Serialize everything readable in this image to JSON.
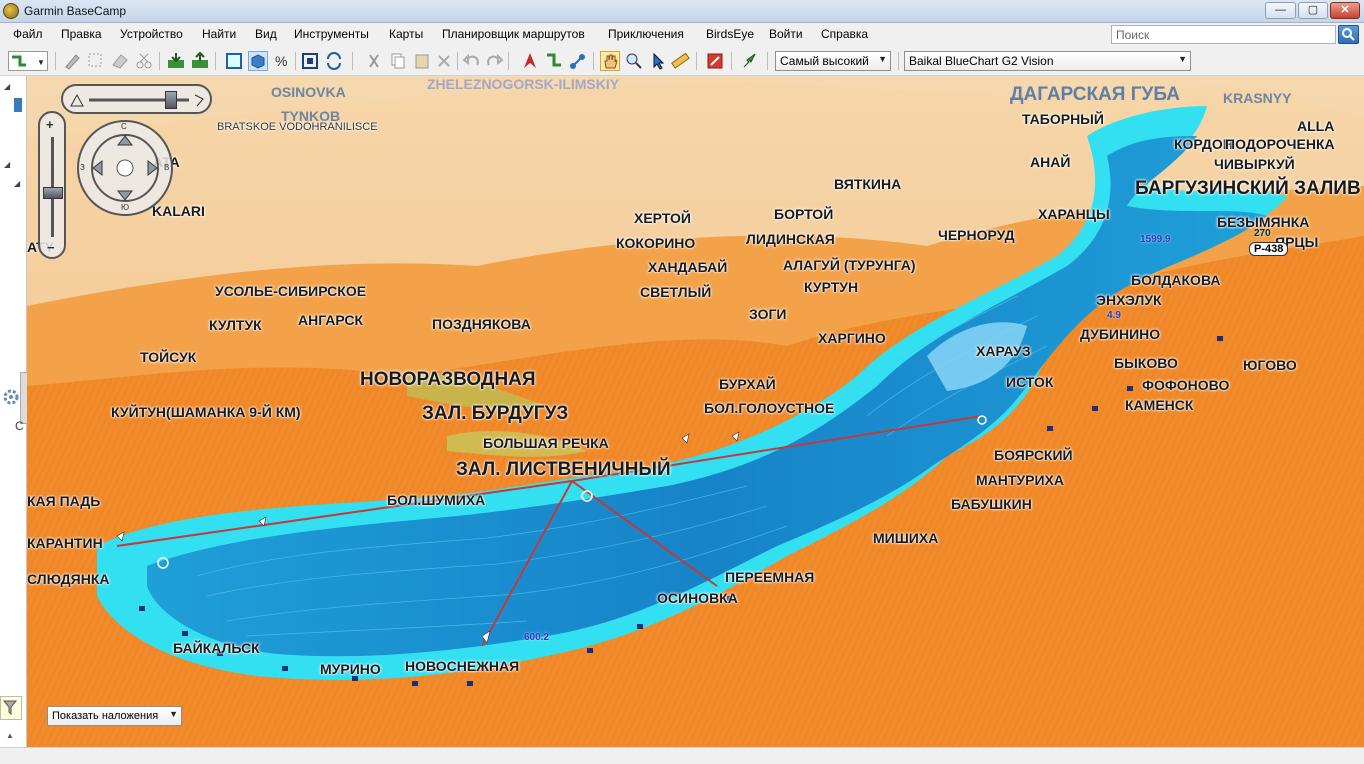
{
  "window": {
    "title": "Garmin BaseCamp",
    "min_glyph": "—",
    "max_glyph": "▢",
    "close_glyph": "✕"
  },
  "menu": [
    "Файл",
    "Правка",
    "Устройство",
    "Найти",
    "Вид",
    "Инструменты",
    "Карты",
    "Планировщик маршрутов",
    "Приключения",
    "BirdsEye",
    "Войти",
    "Справка"
  ],
  "search": {
    "placeholder": "Поиск"
  },
  "toolbar": {
    "detail_select": "Самый высокий",
    "map_select": "Baikal BlueChart G2 Vision",
    "icons": [
      "route-tool-icon",
      "pencil-icon",
      "select-icon",
      "eraser-icon",
      "scissors-icon",
      "send-device-icon",
      "receive-device-icon",
      "rect-select-icon",
      "3d-view-icon",
      "percent-icon",
      "fit-icon",
      "sync-icon",
      "cut-icon",
      "copy-icon",
      "paste-icon",
      "delete-icon",
      "undo-icon",
      "redo-icon",
      "track-icon",
      "route-icon",
      "waypoints-icon",
      "hand-icon",
      "zoom-icon",
      "pointer-icon",
      "ruler-icon",
      "no-icon",
      "launch-icon"
    ]
  },
  "sidebar": {
    "glyph_c": "С"
  },
  "map": {
    "overlay_select": "Показать наложения",
    "labels": {
      "osinovka_n": "OSINOVKA",
      "tynkob": "TYNKOB",
      "bratskoe": "BRATSKOE VODOHRANILISCE",
      "zheleznogorsk": "ZHELEZNOGORSK-ILIMSKIY",
      "dagarskaya": "ДАГАРСКАЯ ГУБА",
      "krasny": "KRASNYY",
      "tabornyi": "ТАБОРНЫЙ",
      "alla": "ALLA",
      "kordon": "КОРДОН",
      "podorochenka": "ПОДОРОЧЕНКА",
      "anai": "АНАЙ",
      "chivyrkui": "ЧИВЫРКУЙ",
      "barguzinsky": "БАРГУЗИНСКИЙ ЗАЛИВ",
      "vyatkina": "ВЯТКИНА",
      "hertoy": "ХЕРТОЙ",
      "bortoy": "БОРТОЙ",
      "harantsy": "ХАРАНЦЫ",
      "bezymyanka": "БЕЗЫМЯНКА",
      "korino": "КОКОРИНО",
      "lidinskaya": "ЛИДИНСКАЯ",
      "chernorud": "ЧЕРНОРУД",
      "yartsy": "ЯРЦЫ",
      "handabai": "ХАНДАБАЙ",
      "alagui": "АЛАГУЙ (ТУРУНГА)",
      "boldakova": "БОЛДАКОВА",
      "svetlyi": "СВЕТЛЫЙ",
      "kurtun": "КУРТУН",
      "usolie": "УСОЛЬЕ-СИБИРСКОЕ",
      "enheluk": "ЭНХЭЛУК",
      "zogi": "ЗОГИ",
      "kultuk": "КУЛТУК",
      "angarsk": "АНГАРСК",
      "pozdnyakova": "ПОЗДНЯКОВА",
      "dubinino": "ДУБИНИНО",
      "hargino": "ХАРГИНО",
      "haraus": "ХАРАУЗ",
      "toisuk": "ТОЙСУК",
      "bykovo": "БЫКОВО",
      "yugovo": "ЮГОВО",
      "novorazvodnaya": "НОВОРАЗВОДНАЯ",
      "burhai": "БУРХАЙ",
      "istok": "ИСТОК",
      "fofonovo": "ФОФОНОВО",
      "kuitun": "КУЙТУН(ШАМАНКА 9-Й КМ)",
      "burduguz": "ЗАЛ. БУРДУГУЗ",
      "bol_goloustnoe": "БОЛ.ГОЛОУСТНОЕ",
      "kamensk": "КАМЕНСК",
      "bolshaya_rechka": "БОЛЬШАЯ РЕЧКА",
      "listvenichny": "ЗАЛ. ЛИСТВЕНИЧНЫЙ",
      "boyarsky": "БОЯРСКИЙ",
      "manturiha": "МАНТУРИХА",
      "kaya_pad": "КАЯ ПАДЬ",
      "bol_shumiha": "БОЛ.ШУМИХА",
      "babushkin": "БАБУШКИН",
      "karantin": "КАРАНТИН",
      "mishiha": "МИШИХА",
      "slyudyanka": "СЛЮДЯНКА",
      "pereemnaya": "ПЕРЕЕМНАЯ",
      "osinovka": "ОСИНОВКА",
      "baikalsk": "БАЙКАЛЬСК",
      "murino": "МУРИНО",
      "novosnezhnaya": "НОВОСНЕЖНАЯ",
      "kalari": "KALARI",
      "ata": "ATA",
      "aty": "ATY"
    },
    "depths": {
      "d1": "1599.9",
      "d2": "4.9",
      "d3": "600.2",
      "d4": "270"
    },
    "road_badge": "P-438",
    "compass_letters": [
      "В",
      "З",
      "С",
      "Ю"
    ]
  },
  "colors": {
    "land": "#f08a2a",
    "land_light": "#f3c48c",
    "water_deep": "#1b8fd1",
    "water_shallow": "#2fd9f0",
    "route": "#c4393a"
  }
}
